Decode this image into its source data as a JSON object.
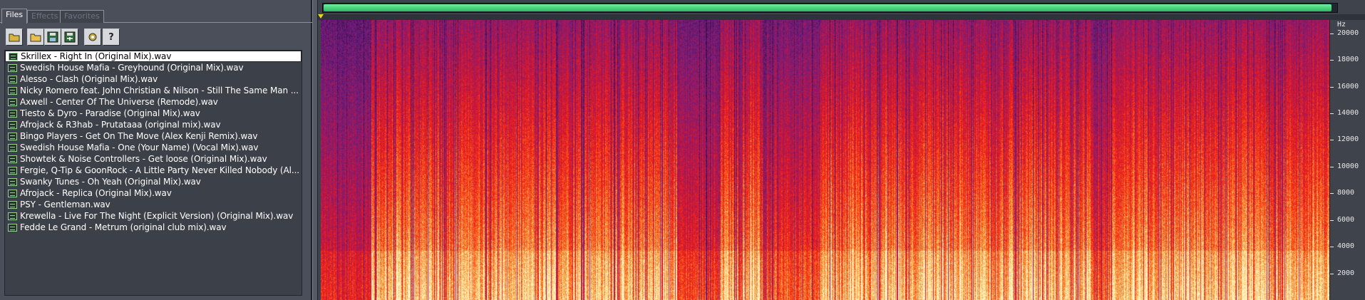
{
  "tabs": [
    {
      "label": "Files",
      "active": true
    },
    {
      "label": "Effects",
      "active": false
    },
    {
      "label": "Favorites",
      "active": false
    }
  ],
  "toolbar": {
    "buttons": [
      {
        "icon": "open-folder-icon"
      },
      {
        "icon": "folder-icon"
      },
      {
        "icon": "save-icon"
      },
      {
        "icon": "save-as-icon"
      },
      {
        "icon": "settings-icon"
      },
      {
        "icon": "help-icon"
      }
    ]
  },
  "files": [
    {
      "name": "Skrillex - Right In (Original Mix).wav",
      "selected": true
    },
    {
      "name": "Swedish House Mafia - Greyhound (Original Mix).wav"
    },
    {
      "name": "Alesso - Clash (Original Mix).wav"
    },
    {
      "name": "Nicky Romero feat. John Christian & Nilson - Still The Same Man ..."
    },
    {
      "name": "Axwell - Center Of The Universe (Remode).wav"
    },
    {
      "name": "Tiesto & Dyro - Paradise (Original Mix).wav"
    },
    {
      "name": "Afrojack & R3hab - Prutataaa (original mix).wav"
    },
    {
      "name": "Bingo Players - Get On The Move (Alex Kenji Remix).wav"
    },
    {
      "name": "Swedish House Mafia - One (Your Name) (Vocal Mix).wav"
    },
    {
      "name": "Showtek & Noise Controllers - Get loose (Original Mix).wav"
    },
    {
      "name": "Fergie, Q-Tip & GoonRock - A Little Party Never Killed Nobody (Al..."
    },
    {
      "name": "Swanky Tunes - Oh Yeah (Original Mix).wav"
    },
    {
      "name": "Afrojack - Replica (Original Mix).wav"
    },
    {
      "name": "PSY - Gentleman.wav"
    },
    {
      "name": "Krewella - Live For The Night (Explicit Version) (Original Mix).wav"
    },
    {
      "name": "Fedde Le Grand - Metrum (original club mix).wav"
    }
  ],
  "playback": {
    "progress": 0.995
  },
  "spectrogram": {
    "unit": "Hz",
    "axis_max": 21000,
    "ticks": [
      "20000",
      "18000",
      "16000",
      "14000",
      "12000",
      "10000",
      "8000",
      "6000",
      "4000",
      "2000"
    ],
    "tick_values": [
      20000,
      18000,
      16000,
      14000,
      12000,
      10000,
      8000,
      6000,
      4000,
      2000
    ]
  },
  "colors": {
    "progress": "#4fd884",
    "marker": "#f0d020",
    "spec_low": "#fff0b0",
    "spec_mid": "#ff3010",
    "spec_high": "#5a1a8a"
  }
}
